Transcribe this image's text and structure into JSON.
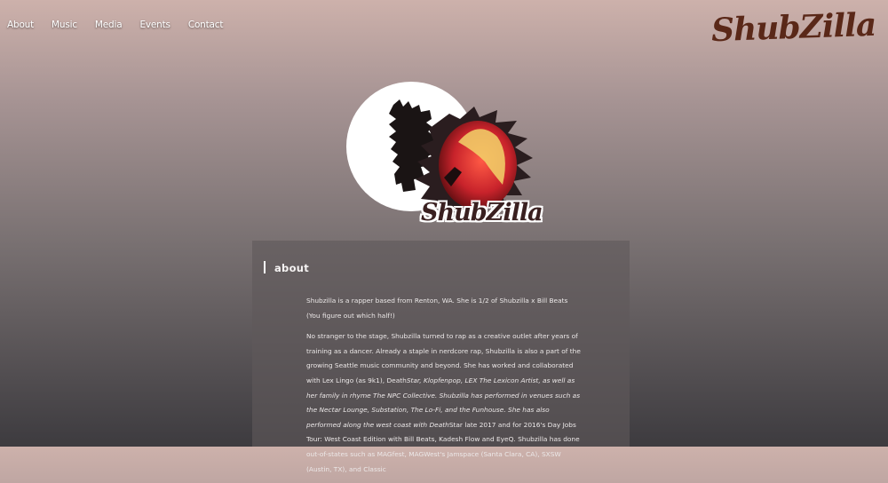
{
  "nav": {
    "items": [
      {
        "label": "About"
      },
      {
        "label": "Music"
      },
      {
        "label": "Media"
      },
      {
        "label": "Events"
      },
      {
        "label": "Contact"
      }
    ]
  },
  "brand": {
    "wordmark": "ShubZilla",
    "color": "#5a2818"
  },
  "hero": {
    "wordmark": "ShubZilla"
  },
  "about": {
    "heading": "about",
    "p1": "Shubzilla is a rapper based from Renton, WA. She is 1/2 of Shubzilla x Bill Beats (You figure out which half!)",
    "p2_a": "No stranger to the stage, Shubzilla turned to rap as a creative outlet after years of training as a dancer. Already a staple in nerdcore rap, Shubzilla is also a part of the growing Seattle music community and beyond. She has worked and collaborated with Lex Lingo (as 9k1), Death",
    "p2_b": "Star, Klopfenpop, LEX The Lexicon Artist, as well as her family in rhyme The NPC Collective. Shubzilla has performed in venues such as the Nectar Lounge, Substation, The Lo-Fi, and the Funhouse. She has also performed along the west coast with Death",
    "p2_c": "Star late 2017 and for 2016's Day Jobs Tour: West Coast Edition with Bill Beats, Kadesh Flow and EyeQ. Shubzilla has done out-of-states such as MAGfest, MAGWest's Jamspace (Santa Clara, CA), SXSW (Austin, TX), and Classic"
  },
  "colors": {
    "panel_bg": "#60595a",
    "hero_red": "#c8232b"
  }
}
